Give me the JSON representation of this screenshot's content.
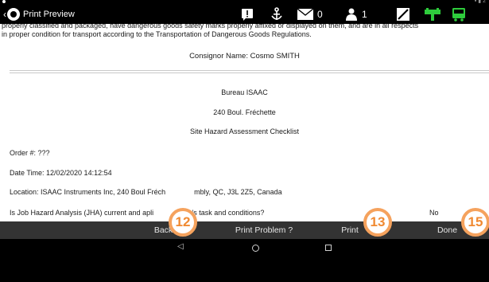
{
  "app_bar": {
    "title": "Print Preview",
    "messages_count": "0",
    "users_count": "1"
  },
  "document": {
    "declaration_line1": "properly classified and packaged, have dangerous goods safety marks properly affixed or displayed on them, and are in all respects",
    "declaration_line2": "in proper condition for transport according to the Transportation of Dangerous Goods Regulations.",
    "consignor": "Consignor Name:  Cosmo SMITH",
    "company": "Bureau ISAAC",
    "address": "240 Boul. Fréchette",
    "form_title": "Site Hazard Assessment Checklist",
    "order": "Order #: ???",
    "datetime": "Date Time: 12/02/2020 14:12:54",
    "location_start": "Location: ISAAC Instruments Inc, 240 Boul Fréch",
    "location_end": "mbly, QC, J3L 2Z5, Canada",
    "question_start": "Is Job Hazard Analysis (JHA) current and apli",
    "question_end": "y's task and conditions?",
    "answer": "No"
  },
  "badges": [
    "12",
    "13",
    "15"
  ],
  "buttons": {
    "back": "Back",
    "print_problem": "Print Problem ?",
    "print": "Print",
    "done": "Done"
  },
  "colors": {
    "badge_border": "#f5a25d",
    "badge_text": "#f08a32",
    "button_bar": "#333333",
    "green_icon": "#2ecc3c"
  }
}
